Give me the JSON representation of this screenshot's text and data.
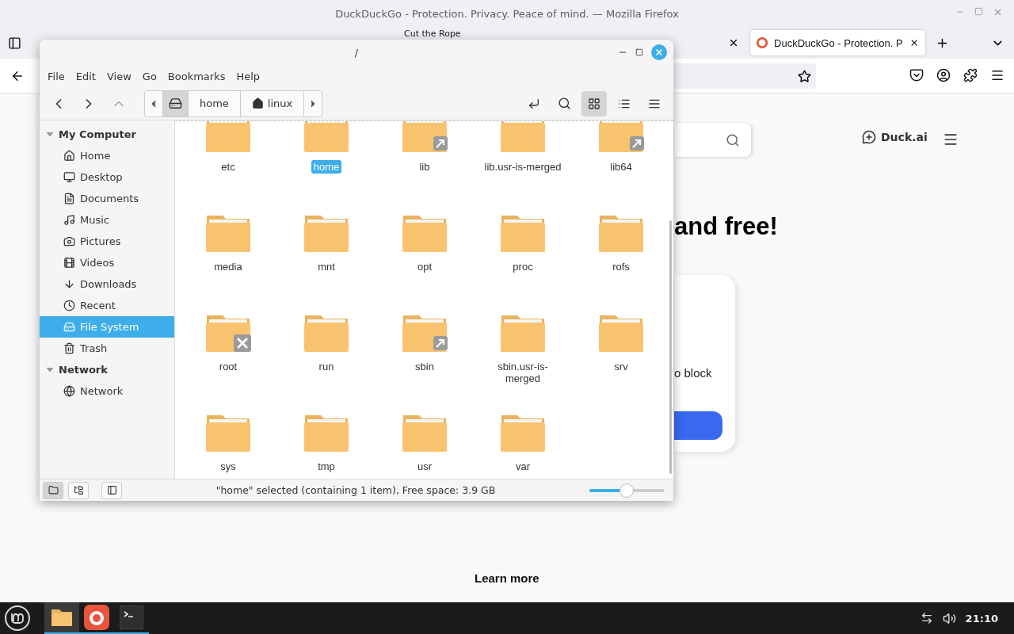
{
  "firefox": {
    "title": "DuckDuckGo - Protection. Privacy. Peace of mind. — Mozilla Firefox",
    "tabs": [
      {
        "label": "Cut the Rope",
        "selected": false
      },
      {
        "label": "DuckDuckGo - Protection. P",
        "selected": true
      }
    ],
    "page": {
      "duck_ai": "Duck.ai",
      "heading": "and free!",
      "card_text": "o block",
      "learn_more": "Learn more"
    }
  },
  "file_manager": {
    "title": "/",
    "menu": [
      "File",
      "Edit",
      "View",
      "Go",
      "Bookmarks",
      "Help"
    ],
    "nav_buttons": [
      {
        "kind": "back",
        "disabled": false
      },
      {
        "kind": "forward",
        "disabled": false
      },
      {
        "kind": "up",
        "disabled": true
      }
    ],
    "path": [
      {
        "kind": "root",
        "selected": true
      },
      {
        "kind": "folder",
        "label": "home",
        "selected": false
      },
      {
        "kind": "home",
        "label": "linux",
        "selected": false
      }
    ],
    "views": [
      {
        "kind": "icons",
        "selected": true
      },
      {
        "kind": "list",
        "selected": false
      },
      {
        "kind": "compact",
        "selected": false
      }
    ],
    "sidebar": [
      {
        "label": "My Computer",
        "expanded": true,
        "children": [
          {
            "label": "Home",
            "kind": "home",
            "selected": false
          },
          {
            "label": "Desktop",
            "kind": "desktop",
            "selected": false
          },
          {
            "label": "Documents",
            "kind": "documents",
            "selected": false
          },
          {
            "label": "Music",
            "kind": "music",
            "selected": false
          },
          {
            "label": "Pictures",
            "kind": "pictures",
            "selected": false
          },
          {
            "label": "Videos",
            "kind": "videos",
            "selected": false
          },
          {
            "label": "Downloads",
            "kind": "downloads",
            "selected": false
          },
          {
            "label": "Recent",
            "kind": "recent",
            "selected": false
          },
          {
            "label": "File System",
            "kind": "filesystem",
            "selected": true
          },
          {
            "label": "Trash",
            "kind": "trash",
            "selected": false
          }
        ]
      },
      {
        "label": "Network",
        "expanded": true,
        "children": [
          {
            "label": "Network",
            "kind": "network",
            "selected": false
          }
        ]
      }
    ],
    "files": [
      {
        "name": "etc",
        "kind": "folder",
        "selected": false
      },
      {
        "name": "home",
        "kind": "folder",
        "selected": true
      },
      {
        "name": "lib",
        "kind": "link",
        "selected": false
      },
      {
        "name": "lib.usr-is-merged",
        "kind": "folder",
        "selected": false
      },
      {
        "name": "lib64",
        "kind": "link",
        "selected": false
      },
      {
        "name": "media",
        "kind": "folder",
        "selected": false
      },
      {
        "name": "mnt",
        "kind": "folder",
        "selected": false
      },
      {
        "name": "opt",
        "kind": "folder",
        "selected": false
      },
      {
        "name": "proc",
        "kind": "folder",
        "selected": false
      },
      {
        "name": "rofs",
        "kind": "folder",
        "selected": false
      },
      {
        "name": "root",
        "kind": "locked",
        "selected": false
      },
      {
        "name": "run",
        "kind": "folder",
        "selected": false
      },
      {
        "name": "sbin",
        "kind": "link",
        "selected": false
      },
      {
        "name": "sbin.usr-is-merged",
        "kind": "folder",
        "selected": false
      },
      {
        "name": "srv",
        "kind": "folder",
        "selected": false
      },
      {
        "name": "sys",
        "kind": "folder",
        "selected": false
      },
      {
        "name": "tmp",
        "kind": "folder",
        "selected": false
      },
      {
        "name": "usr",
        "kind": "folder",
        "selected": false
      },
      {
        "name": "var",
        "kind": "folder",
        "selected": false
      }
    ],
    "pane_buttons": [
      {
        "kind": "places",
        "selected": true
      },
      {
        "kind": "tree",
        "selected": false
      }
    ],
    "status": "\"home\" selected (containing 1 item), Free space: 3.9 GB",
    "zoom": {
      "level": 0.5
    }
  },
  "taskbar": {
    "apps": [
      {
        "kind": "files",
        "active": true
      },
      {
        "kind": "firefox",
        "active": false
      },
      {
        "kind": "terminal",
        "active": false
      }
    ],
    "clock": "21:10"
  }
}
